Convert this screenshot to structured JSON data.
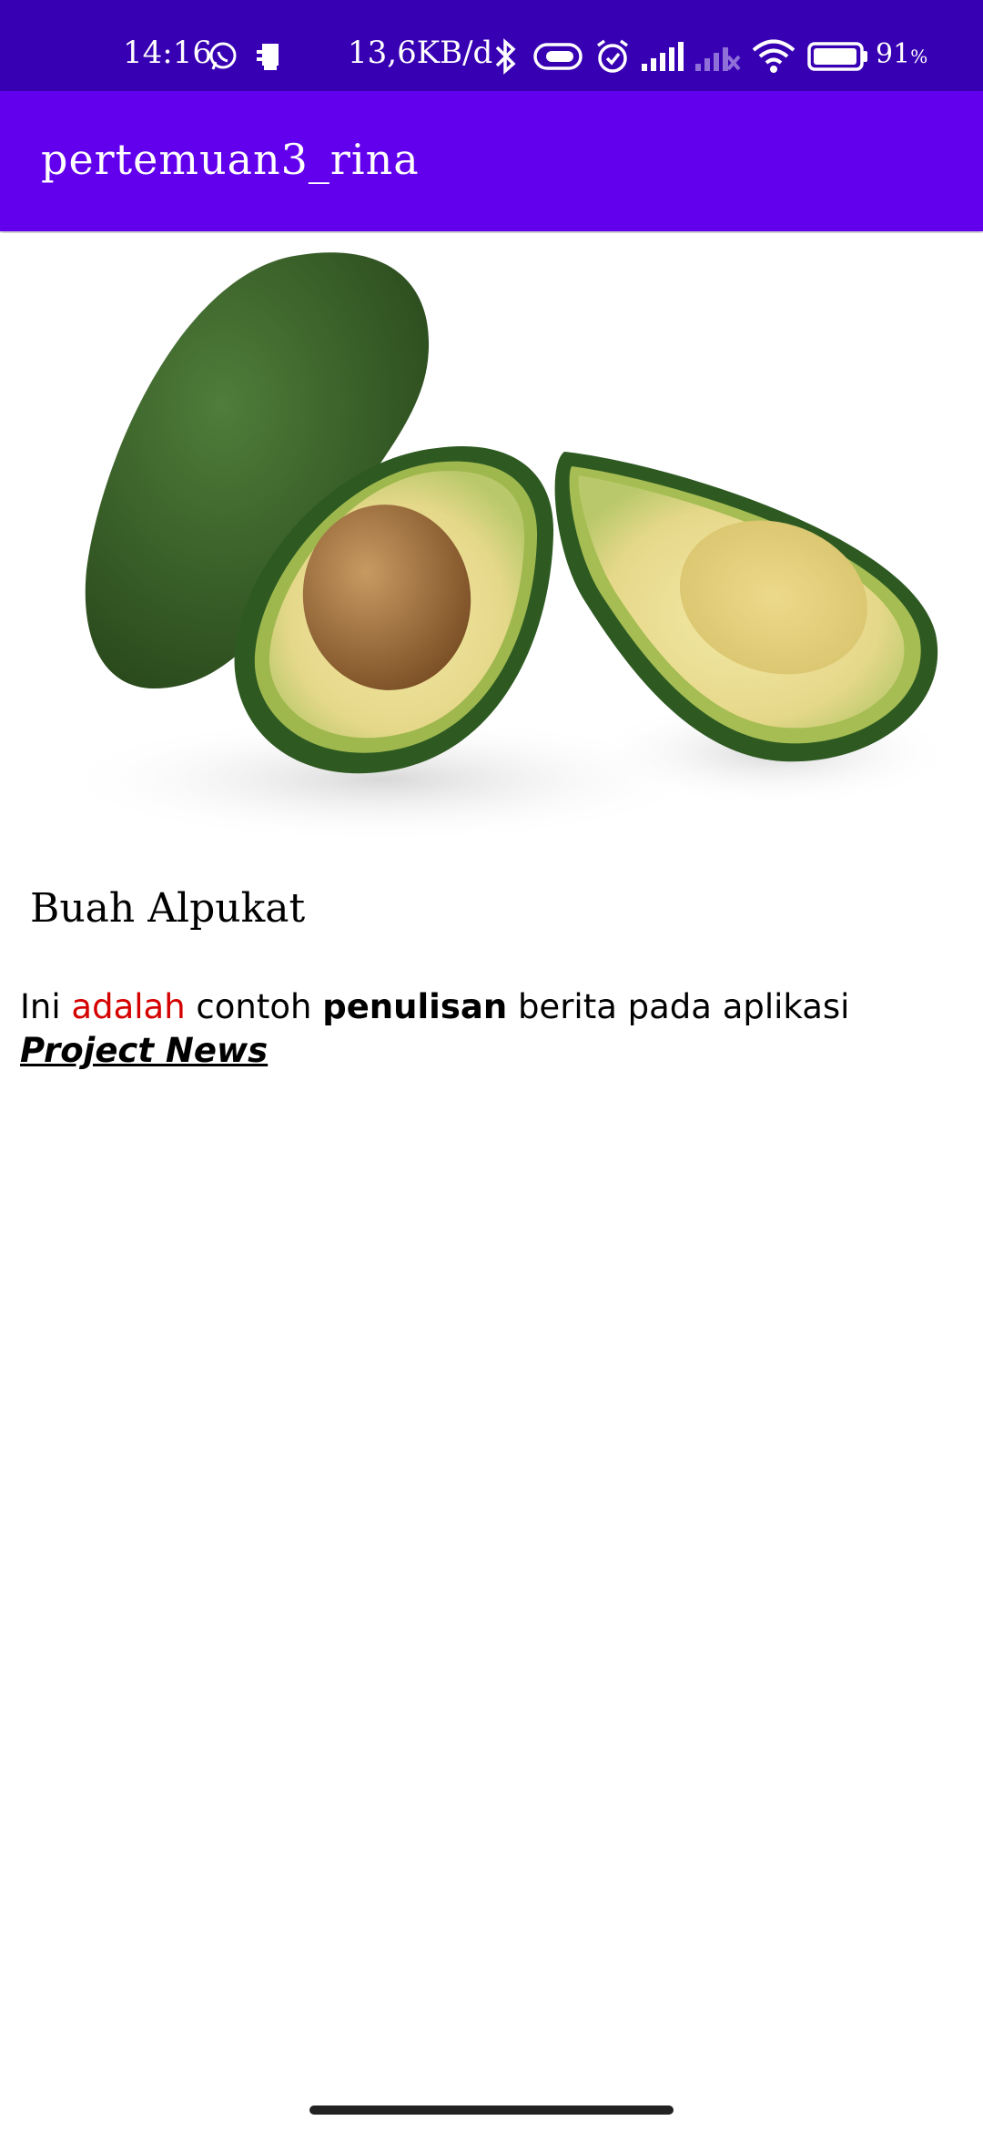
{
  "status_bar": {
    "time": "14:16",
    "network_speed": "13,6KB/d",
    "battery_percent": "91",
    "battery_symbol": "%",
    "icons": [
      "whatsapp-icon",
      "sim-tray-icon",
      "bluetooth-icon",
      "toggle-icon",
      "alarm-icon",
      "signal-icon",
      "signal-no-service-icon",
      "wifi-icon",
      "battery-icon"
    ]
  },
  "app_bar": {
    "title": "pertemuan3_rina"
  },
  "image": {
    "subject": "avocado"
  },
  "article": {
    "title": "Buah Alpukat",
    "body": {
      "part1": "Ini ",
      "part2_red": "adalah",
      "part3": " contoh ",
      "part4_bold": "penulisan",
      "part5": " berita pada aplikasi ",
      "part6_bold_italic_underline": "Project News"
    }
  },
  "colors": {
    "status_bar": "#3700b3",
    "app_bar": "#6200ee",
    "highlight_red": "#d50000"
  }
}
